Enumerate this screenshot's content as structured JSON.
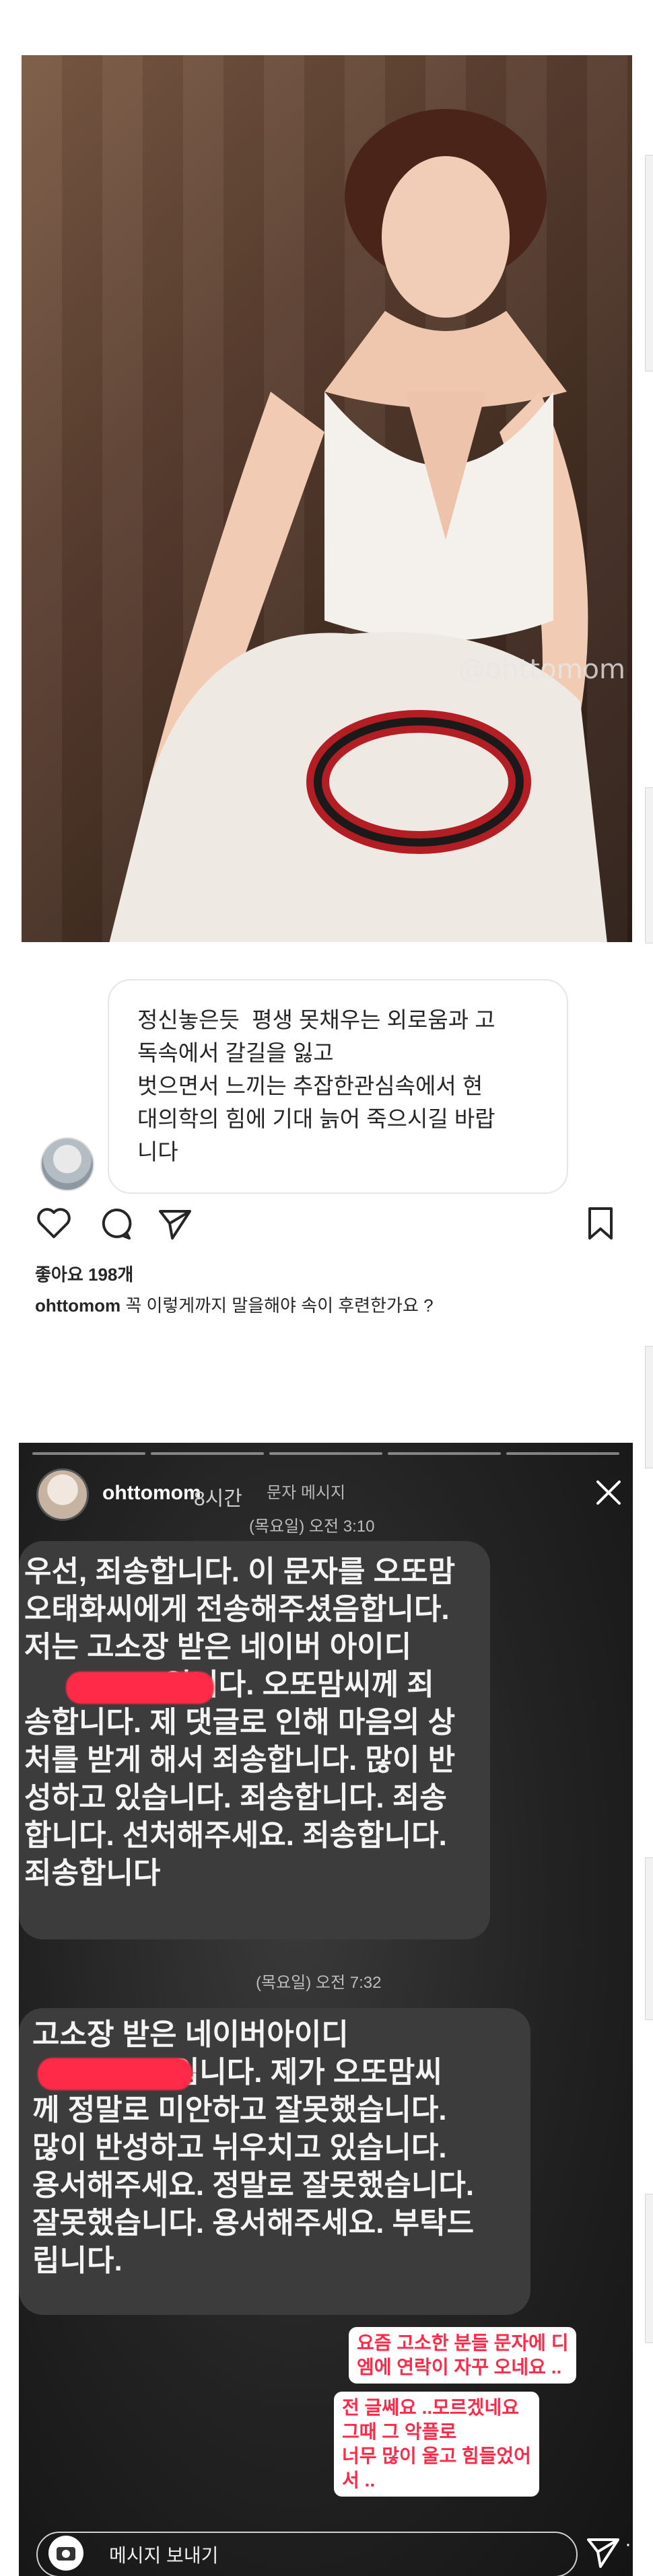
{
  "photo": {
    "watermark": "@ohttomom"
  },
  "post": {
    "comment": "정신놓은듯  평생 못채우는 외로움과 고\n독속에서 갈길을 잃고\n벗으면서 느끼는 추잡한관심속에서 현\n대의학의 힘에 기대 늙어 죽으시길 바랍\n니다",
    "likes": "좋아요 198개",
    "caption_user": "ohttomom",
    "caption_text": "꼭 이렇게까지 말을해야 속이 후련한가요 ?",
    "icons": [
      "heart-icon",
      "comment-icon",
      "share-icon",
      "bookmark-icon"
    ]
  },
  "story": {
    "username": "ohttomom",
    "time": "8시간",
    "sms_label": "문자 메시지",
    "ts1": "(목요일) 오전 3:10",
    "msg1": "우선, 죄송합니다. 이 문자를 오또맘\n오태화씨에게 전송해주셨음합니다.\n저는 고소장 받은 네이버 아이디\n                 입니다. 오또맘씨께 죄\n송합니다. 제 댓글로 인해 마음의 상\n처를 받게 해서 죄송합니다. 많이 반\n성하고 있습니다. 죄송합니다. 죄송\n합니다. 선처해주세요. 죄송합니다.\n죄송합니다",
    "ts2": "(목요일) 오전 7:32",
    "msg2": "고소장 받은 네이버아이디\n                 입니다. 제가 오또맘씨\n께 정말로 미안하고 잘못했습니다.\n많이 반성하고 뉘우치고 있습니다.\n용서해주세요. 정말로 잘못했습니다.\n잘못했습니다. 용서해주세요. 부탁드\n립니다.",
    "sticker1": "요즘 고소한 분들 문자에 디\n엠에 연락이 자꾸 오네요 ..",
    "sticker2": "전 글쎄요 ..모르겠네요\n그때 그 악플로\n너무 많이 울고 힘들었어\n서 ..",
    "reply_placeholder": "메시지 보내기",
    "more": "···",
    "colors": {
      "sticker_text": "#ff2a48",
      "bubble": "#3c3c3c",
      "redact": "#ff2a48"
    }
  }
}
